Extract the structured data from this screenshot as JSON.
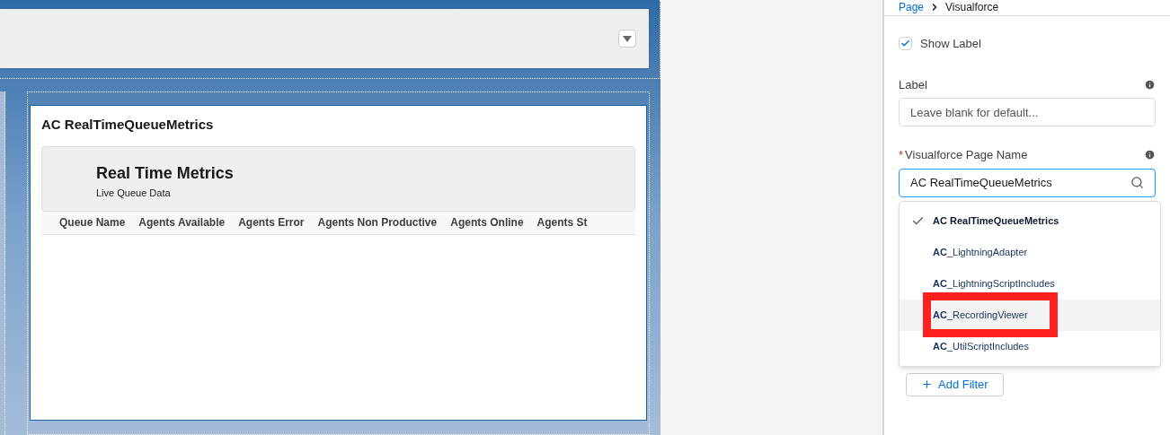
{
  "breadcrumb": {
    "items": [
      "Page",
      "Visualforce"
    ]
  },
  "component": {
    "title": "AC RealTimeQueueMetrics",
    "header": {
      "title": "Real Time Metrics",
      "subtitle": "Live Queue Data"
    },
    "table": {
      "columns": [
        "Queue Name",
        "Agents Available",
        "Agents Error",
        "Agents Non Productive",
        "Agents Online",
        "Agents St"
      ]
    }
  },
  "properties": {
    "show_label": {
      "label": "Show Label",
      "checked": true
    },
    "label_field": {
      "label": "Label",
      "placeholder": "Leave blank for default..."
    },
    "page_name_field": {
      "label": "Visualforce Page Name",
      "required_mark": "*",
      "value": "AC RealTimeQueueMetrics"
    },
    "options": [
      {
        "prefix": "AC",
        "rest": " RealTimeQueueMetrics",
        "selected": true,
        "hovered": false,
        "highlighted": false
      },
      {
        "prefix": "AC",
        "rest": "_LightningAdapter",
        "selected": false,
        "hovered": false,
        "highlighted": false
      },
      {
        "prefix": "AC",
        "rest": "_LightningScriptIncludes",
        "selected": false,
        "hovered": false,
        "highlighted": false
      },
      {
        "prefix": "AC",
        "rest": "_RecordingViewer",
        "selected": false,
        "hovered": true,
        "highlighted": true
      },
      {
        "prefix": "AC",
        "rest": "_UtilScriptIncludes",
        "selected": false,
        "hovered": false,
        "highlighted": false
      }
    ],
    "add_filter": "Add Filter"
  }
}
